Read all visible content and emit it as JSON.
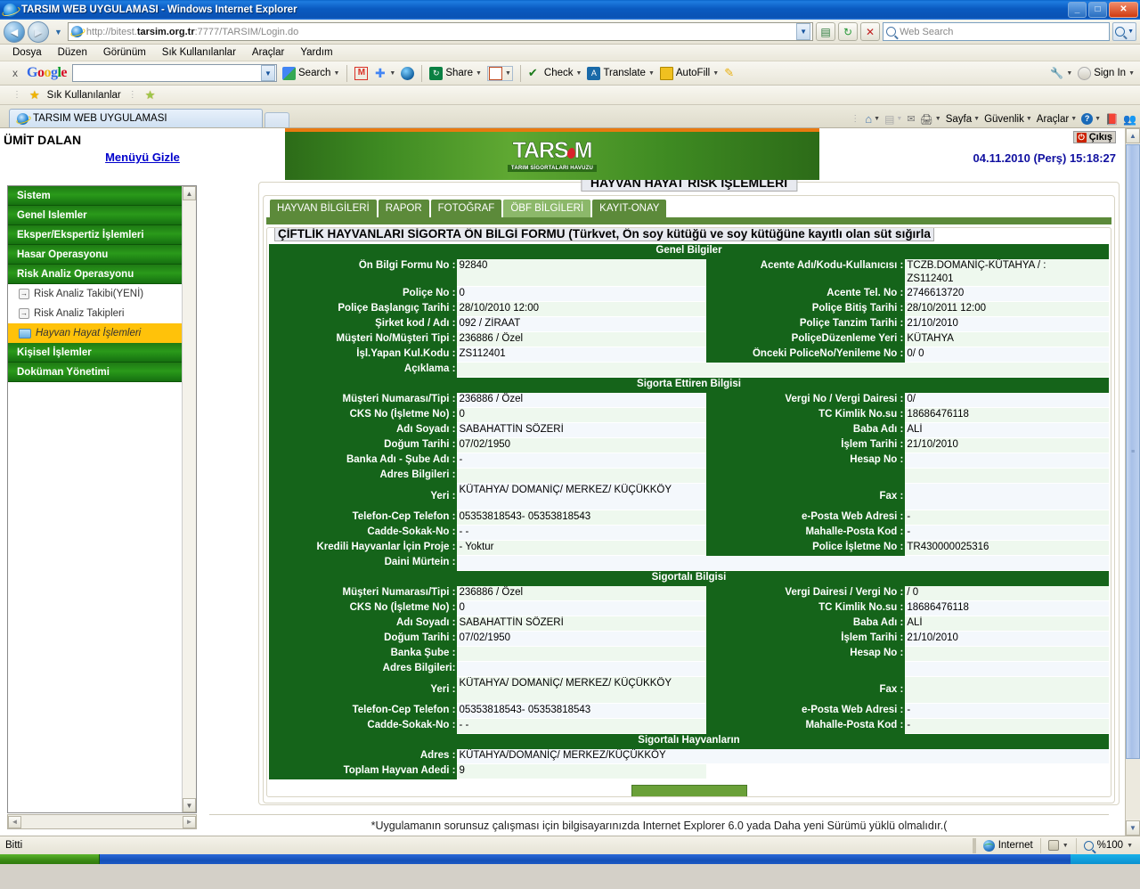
{
  "window": {
    "title": "TARSIM WEB UYGULAMASI - Windows Internet Explorer",
    "minimize": "_",
    "maximize": "□",
    "close": "✕"
  },
  "address_bar": {
    "back_icon": "◄",
    "forward_icon": "►",
    "url_scheme": "http://",
    "url_host_dim": "bitest.",
    "url_host_strong": "tarsim.org.tr",
    "url_rest": ":7777/TARSIM/Login.do",
    "dropdown_caret": "▼",
    "stop_icon": "✕",
    "refresh_icon": "↻",
    "feed_icon": "▤",
    "search_placeholder": "Web Search",
    "search_caret": "▼"
  },
  "menu_bar": {
    "items": [
      "Dosya",
      "Düzen",
      "Görünüm",
      "Sık Kullanılanlar",
      "Araçlar",
      "Yardım"
    ]
  },
  "google_toolbar": {
    "close_label": "x",
    "logo": [
      "G",
      "o",
      "o",
      "g",
      "l",
      "e"
    ],
    "input_value": "",
    "search_label": "Search",
    "gmail_icon": "M",
    "plus_icon": "✚",
    "globe_icon": "◍",
    "share_label": "Share",
    "popup_icon": "▭",
    "check_label": "Check",
    "translate_label": "Translate",
    "autofill_label": "AutoFill",
    "pencil_icon": "✎",
    "wrench_icon": "🔧",
    "signin_label": "Sign In",
    "caret": "▼"
  },
  "favorites_bar": {
    "star_icon": "★",
    "label": "Sık Kullanılanlar",
    "add_icon": "★"
  },
  "tab_strip": {
    "tab_title": "TARSIM WEB UYGULAMASI",
    "new_tab_label": "",
    "commands": [
      {
        "name": "home",
        "icon": "⌂",
        "label": "",
        "caret": "▼"
      },
      {
        "name": "feeds",
        "icon": "▤",
        "label": "",
        "caret": "▼"
      },
      {
        "name": "mail",
        "icon": "✉",
        "label": "",
        "caret": ""
      },
      {
        "name": "print",
        "icon": "🖨",
        "label": "",
        "caret": "▼"
      },
      {
        "name": "page",
        "icon": "",
        "label": "Sayfa",
        "caret": "▼"
      },
      {
        "name": "safety",
        "icon": "",
        "label": "Güvenlik",
        "caret": "▼"
      },
      {
        "name": "tools",
        "icon": "",
        "label": "Araçlar",
        "caret": "▼"
      },
      {
        "name": "help",
        "icon": "?",
        "label": "",
        "caret": "▼"
      }
    ]
  },
  "app_header": {
    "username": "ÜMİT DALAN",
    "hide_menu_link": "Menüyü Gizle",
    "logo_text_1": "TARS",
    "logo_text_2": "M",
    "logo_subtitle": "TARIM SİGORTALARI HAVUZU",
    "logout_label": "Çıkış",
    "logout_icon": "⏻",
    "datetime": "04.11.2010 (Perş) 15:18:27"
  },
  "sidebar": {
    "items": [
      {
        "label": "Sistem",
        "type": "group"
      },
      {
        "label": "Genel Islemler",
        "type": "group"
      },
      {
        "label": "Eksper/Ekspertiz İşlemleri",
        "type": "group"
      },
      {
        "label": "Hasar Operasyonu",
        "type": "group"
      },
      {
        "label": "Risk Analiz Operasyonu",
        "type": "group"
      },
      {
        "label": "Risk Analiz Takibi(YENİ)",
        "type": "sub",
        "icon": "→"
      },
      {
        "label": "Risk Analiz Takipleri",
        "type": "sub",
        "icon": "→"
      },
      {
        "label": "Hayvan Hayat İşlemleri",
        "type": "sub-active",
        "icon": "folder"
      },
      {
        "label": "Kişisel İşlemler",
        "type": "group"
      },
      {
        "label": "Doküman Yönetimi",
        "type": "group"
      }
    ],
    "scroll_up": "▲",
    "scroll_down": "▼",
    "hscroll_left": "◄",
    "hscroll_right": "►"
  },
  "main": {
    "page_title": "HAYVAN HAYAT RİSK İŞLEMLERİ",
    "tabs": [
      {
        "label": "HAYVAN BİLGİLERİ",
        "selected": false
      },
      {
        "label": "RAPOR",
        "selected": false
      },
      {
        "label": "FOTOĞRAF",
        "selected": false
      },
      {
        "label": "ÖBF BİLGİLERİ",
        "selected": true
      },
      {
        "label": "KAYIT-ONAY",
        "selected": false
      }
    ],
    "form_title": "ÇİFTLİK HAYVANLARI SİGORTA ÖN BİLGİ FORMU (Türkvet, Ön soy kütüğü ve soy kütüğüne kayıtlı olan süt sığırla",
    "sections": [
      {
        "title": "Genel Bilgiler",
        "rows": [
          {
            "l1": "Ön Bilgi Formu No :",
            "v1": "92840",
            "l2": "Acente Adı/Kodu-Kullanıcısı :",
            "v2": "TCZB.DOMANİÇ-KÜTAHYA / :\nZS112401",
            "tall": true
          },
          {
            "l1": "Poliçe No :",
            "v1": "0",
            "l2": "Acente Tel. No :",
            "v2": "2746613720"
          },
          {
            "l1": "Poliçe Başlangıç Tarihi :",
            "v1": "28/10/2010 12:00",
            "l2": "Poliçe Bitiş Tarihi :",
            "v2": "28/10/2011 12:00"
          },
          {
            "l1": "Şirket kod / Adı :",
            "v1": "092 / ZİRAAT",
            "l2": "Poliçe Tanzim Tarihi :",
            "v2": "21/10/2010"
          },
          {
            "l1": "Müşteri No/Müşteri Tipi :",
            "v1": "236886 / Özel",
            "l2": "PoliçeDüzenleme Yeri :",
            "v2": "KÜTAHYA"
          },
          {
            "l1": "İşl.Yapan Kul.Kodu :",
            "v1": "ZS112401",
            "l2": "Önceki PoliceNo/Yenileme No :",
            "v2": "0/ 0"
          },
          {
            "l1": "Açıklama :",
            "v1": "",
            "l2": "",
            "v2": "",
            "single": true
          }
        ]
      },
      {
        "title": "Sigorta Ettiren Bilgisi",
        "rows": [
          {
            "l1": "Müşteri Numarası/Tipi :",
            "v1": "236886 / Özel",
            "l2": "Vergi No / Vergi Dairesi :",
            "v2": "0/"
          },
          {
            "l1": "CKS No (İşletme No) :",
            "v1": "0",
            "l2": "TC Kimlik No.su :",
            "v2": "18686476118"
          },
          {
            "l1": "Adı Soyadı :",
            "v1": "SABAHATTİN SÖZERİ",
            "l2": "Baba Adı :",
            "v2": "ALİ"
          },
          {
            "l1": "Doğum Tarihi :",
            "v1": "07/02/1950",
            "l2": "İşlem Tarihi :",
            "v2": "21/10/2010"
          },
          {
            "l1": "Banka Adı - Şube Adı :",
            "v1": "-",
            "l2": "Hesap No :",
            "v2": ""
          },
          {
            "l1": "Adres Bilgileri :",
            "v1": "",
            "l2": "",
            "v2": ""
          },
          {
            "l1": "Yeri :",
            "v1": "KÜTAHYA/ DOMANİÇ/ MERKEZ/ KÜÇÜKKÖY",
            "l2": "Fax :",
            "v2": "",
            "tall": true
          },
          {
            "l1": "Telefon-Cep Telefon :",
            "v1": "05353818543- 05353818543",
            "l2": "e-Posta Web Adresi :",
            "v2": "-"
          },
          {
            "l1": "Cadde-Sokak-No :",
            "v1": "- -",
            "l2": "Mahalle-Posta Kod :",
            "v2": "-"
          },
          {
            "l1": "Kredili Hayvanlar İçin Proje :",
            "v1": "- Yoktur",
            "l2": "Police İşletme No :",
            "v2": "TR430000025316"
          },
          {
            "l1": "Daini Mürtein :",
            "v1": "",
            "l2": "",
            "v2": "",
            "single": true
          }
        ]
      },
      {
        "title": "Sigortalı Bilgisi",
        "rows": [
          {
            "l1": "Müşteri Numarası/Tipi :",
            "v1": "236886 / Özel",
            "l2": "Vergi Dairesi / Vergi No :",
            "v2": "/ 0"
          },
          {
            "l1": "CKS No (İşletme No) :",
            "v1": "0",
            "l2": "TC Kimlik No.su :",
            "v2": "18686476118"
          },
          {
            "l1": "Adı Soyadı :",
            "v1": "SABAHATTİN SÖZERİ",
            "l2": "Baba Adı :",
            "v2": "ALİ"
          },
          {
            "l1": "Doğum Tarihi :",
            "v1": "07/02/1950",
            "l2": "İşlem Tarihi :",
            "v2": "21/10/2010"
          },
          {
            "l1": "Banka Şube :",
            "v1": "",
            "l2": "Hesap No :",
            "v2": ""
          },
          {
            "l1": "Adres Bilgileri:",
            "v1": "",
            "l2": "",
            "v2": ""
          },
          {
            "l1": "Yeri :",
            "v1": "KÜTAHYA/ DOMANİÇ/ MERKEZ/ KÜÇÜKKÖY",
            "l2": "Fax :",
            "v2": "",
            "tall": true
          },
          {
            "l1": "Telefon-Cep Telefon :",
            "v1": "05353818543- 05353818543",
            "l2": "e-Posta Web Adresi :",
            "v2": "-"
          },
          {
            "l1": "Cadde-Sokak-No :",
            "v1": "- -",
            "l2": "Mahalle-Posta Kod :",
            "v2": "-"
          }
        ]
      },
      {
        "title": "Sigortalı Hayvanların",
        "rows": [
          {
            "l1": "Adres :",
            "v1": "KÜTAHYA/DOMANİÇ/ MERKEZ/KÜÇÜKKÖY",
            "l2": "",
            "v2": "",
            "single": true
          },
          {
            "l1": "Toplam Hayvan Adedi :",
            "v1": "9",
            "l2": "",
            "v2": "",
            "single": true
          }
        ]
      }
    ],
    "footer_note": "*Uygulamanın sorunsuz çalışması için bilgisayarınızda Internet Explorer 6.0 yada Daha yeni Sürümü yüklü olmalıdır.(",
    "scroll_up": "▲",
    "scroll_down": "▼"
  },
  "status_bar": {
    "text": "Bitti",
    "zone_label": "Internet",
    "zone_icon": "globe-icon",
    "protected_caret": "▼",
    "zoom_label": "%100",
    "zoom_caret": "▼"
  },
  "colors": {
    "brand_green": "#15641a",
    "menu_green": "#1e7a14",
    "accent_orange": "#e87a10",
    "active_yellow": "#ffc20a",
    "link_blue": "#0000cc",
    "datetime_blue": "#1010a0"
  }
}
